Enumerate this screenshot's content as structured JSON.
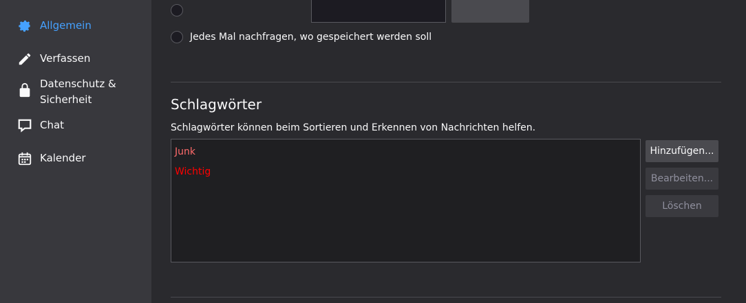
{
  "sidebar": {
    "items": [
      {
        "label": "Allgemein",
        "icon": "gear-icon",
        "active": true
      },
      {
        "label": "Verfassen",
        "icon": "pencil-icon",
        "active": false
      },
      {
        "label": "Datenschutz & Sicherheit",
        "icon": "lock-icon",
        "active": false
      },
      {
        "label": "Chat",
        "icon": "chat-bubble-icon",
        "active": false
      },
      {
        "label": "Kalender",
        "icon": "calendar-icon",
        "active": false
      }
    ]
  },
  "downloads": {
    "ask_label": "Jedes Mal nachfragen, wo gespeichert werden soll"
  },
  "tags": {
    "title": "Schlagwörter",
    "description": "Schlagwörter können beim Sortieren und Erkennen von Nachrichten helfen.",
    "items": [
      {
        "label": "Junk",
        "color": "#ff6b6b"
      },
      {
        "label": "Wichtig",
        "color": "#ff0000"
      }
    ],
    "buttons": {
      "add": "Hinzufügen...",
      "edit": "Bearbeiten...",
      "delete": "Löschen"
    }
  },
  "colors": {
    "accent": "#45a1ff",
    "sidebar_bg": "#38383d",
    "content_bg": "#2a2a2e"
  }
}
